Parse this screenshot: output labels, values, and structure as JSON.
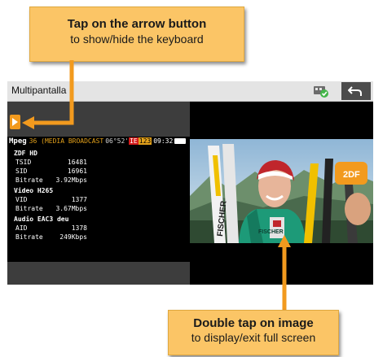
{
  "callouts": {
    "top": {
      "bold": "Tap on the arrow button",
      "text": "to show/hide the keyboard"
    },
    "bottom": {
      "bold": "Double tap on image",
      "text": "to display/exit full screen"
    }
  },
  "window": {
    "title": "Multipantalla"
  },
  "status_bar": {
    "standard": "Mpeg",
    "channel": "36 (MEDIA BROADCAST",
    "position": "06°52'",
    "badge_red": "IE",
    "badge_yellow": "123",
    "time": "09:32"
  },
  "service": {
    "name": "ZDF HD",
    "rows": [
      {
        "label": "TSID",
        "value": "16481"
      },
      {
        "label": "SID",
        "value": "16961"
      },
      {
        "label": "Bitrate",
        "value": "3.92Mbps"
      }
    ]
  },
  "video_stream": {
    "title": "Video H265",
    "rows": [
      {
        "label": "VID",
        "value": "1377"
      },
      {
        "label": "Bitrate",
        "value": "3.67Mbps"
      }
    ]
  },
  "audio_stream": {
    "title": "Audio EAC3 deu",
    "rows": [
      {
        "label": "AID",
        "value": "1378"
      },
      {
        "label": "Bitrate",
        "value": "249Kbps"
      }
    ]
  },
  "video_image": {
    "brand": "FISCHER",
    "bib": "FISCHER",
    "mic_label": "2DF"
  },
  "colors": {
    "accent_orange": "#f29a1e",
    "callout_fill": "#fbc566",
    "channel_text": "#e3a11b"
  },
  "icons": [
    "play-arrow-icon",
    "usb-check-icon",
    "back-arrow-icon"
  ]
}
